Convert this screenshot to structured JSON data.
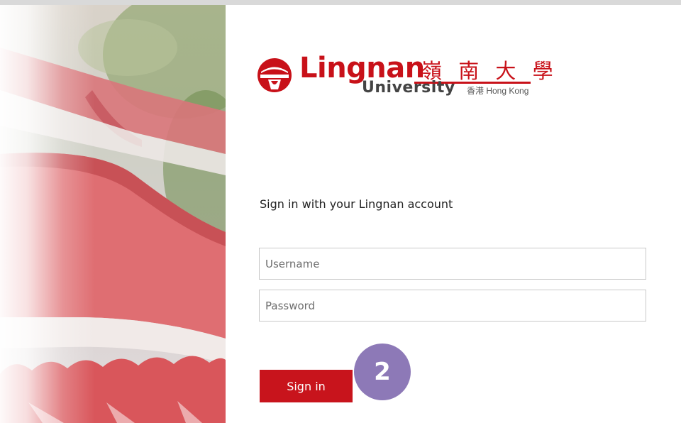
{
  "branding": {
    "name": "Lingnan",
    "chinese_name": "嶺 南 大 學",
    "sub_name": "University",
    "location": "香港 Hong Kong",
    "brand_color": "#c81119"
  },
  "login": {
    "heading": "Sign in with your Lingnan account",
    "username_placeholder": "Username",
    "password_placeholder": "Password",
    "username_value": "",
    "password_value": "",
    "submit_label": "Sign in",
    "button_color": "#c8141c"
  },
  "step_badge": {
    "number": "2",
    "color": "#8d79b7"
  }
}
